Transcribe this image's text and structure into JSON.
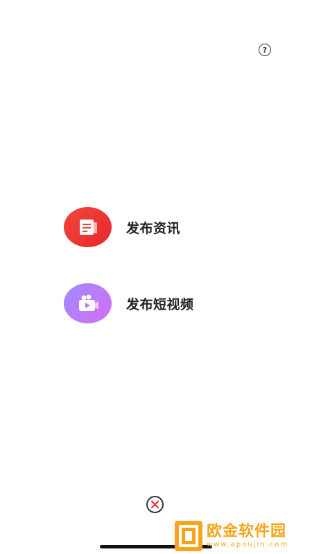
{
  "header": {
    "help_icon": "question-circle-icon",
    "help_glyph": "?"
  },
  "actions": [
    {
      "label": "发布资讯",
      "icon": "news-document-icon",
      "color_from": "#f0473b",
      "color_to": "#e8262a"
    },
    {
      "label": "发布短视频",
      "icon": "video-camera-icon",
      "color_from": "#9d8cff",
      "color_to": "#d66cf3"
    }
  ],
  "footer": {
    "close_icon": "close-icon"
  },
  "watermark": {
    "name": "欧金软件园",
    "url": "www.apoujin.com"
  }
}
